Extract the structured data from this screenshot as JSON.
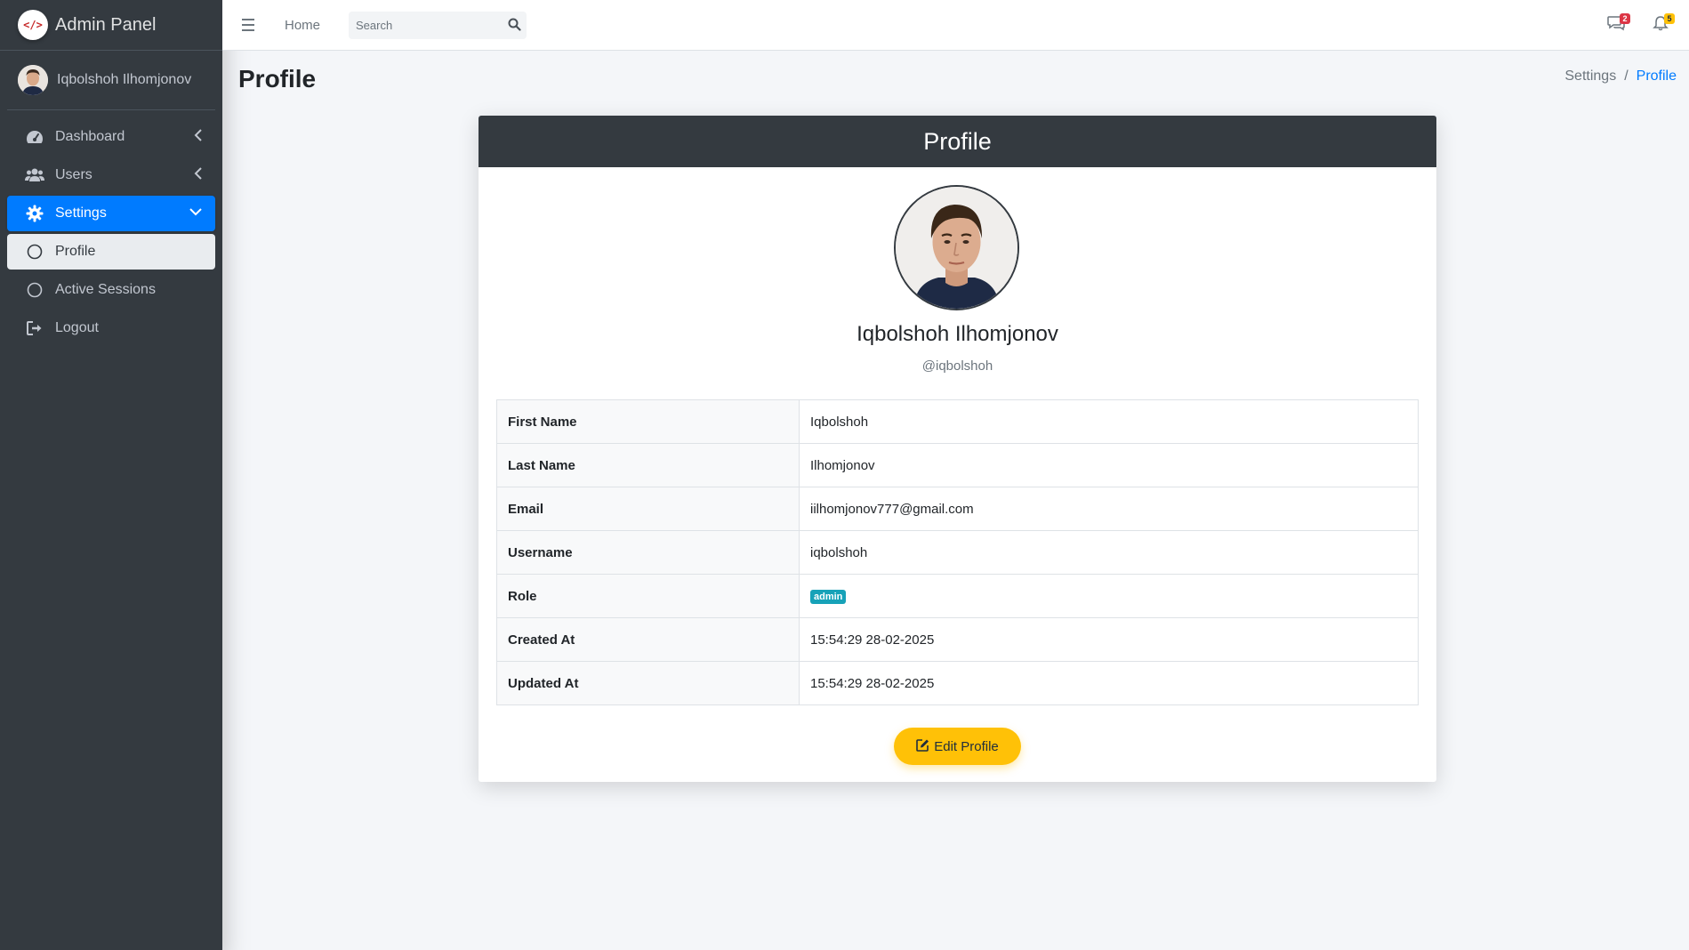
{
  "brand": {
    "title": "Admin Panel",
    "logo_text": "</>",
    "logo_color": "#c62828"
  },
  "user": {
    "name": "Iqbolshoh Ilhomjonov"
  },
  "sidebar": {
    "items": [
      {
        "label": "Dashboard",
        "icon": "dashboard-gauge-icon"
      },
      {
        "label": "Users",
        "icon": "users-icon"
      },
      {
        "label": "Settings",
        "icon": "gear-icon"
      },
      {
        "label": "Profile",
        "icon": "circle-icon"
      },
      {
        "label": "Active Sessions",
        "icon": "circle-icon"
      },
      {
        "label": "Logout",
        "icon": "sign-out-icon"
      }
    ]
  },
  "topbar": {
    "home_label": "Home",
    "search_placeholder": "Search",
    "messages_count": "2",
    "notifications_count": "5"
  },
  "page": {
    "title": "Profile",
    "breadcrumb": {
      "parent": "Settings",
      "separator": "/",
      "current": "Profile"
    }
  },
  "profile": {
    "card_title": "Profile",
    "full_name": "Iqbolshoh Ilhomjonov",
    "handle": "@iqbolshoh",
    "rows": [
      {
        "label": "First Name",
        "value": "Iqbolshoh"
      },
      {
        "label": "Last Name",
        "value": "Ilhomjonov"
      },
      {
        "label": "Email",
        "value": "iilhomjonov777@gmail.com"
      },
      {
        "label": "Username",
        "value": "iqbolshoh"
      },
      {
        "label": "Role",
        "value": "admin"
      },
      {
        "label": "Created At",
        "value": "15:54:29 28-02-2025"
      },
      {
        "label": "Updated At",
        "value": "15:54:29 28-02-2025"
      }
    ],
    "edit_button": "Edit Profile"
  },
  "colors": {
    "sidebar_bg": "#343a40",
    "active_nav": "#007bff",
    "role_badge": "#17a2b8",
    "edit_button": "#ffc107",
    "messages_badge": "#dc3545",
    "notifications_badge": "#ffc107"
  }
}
